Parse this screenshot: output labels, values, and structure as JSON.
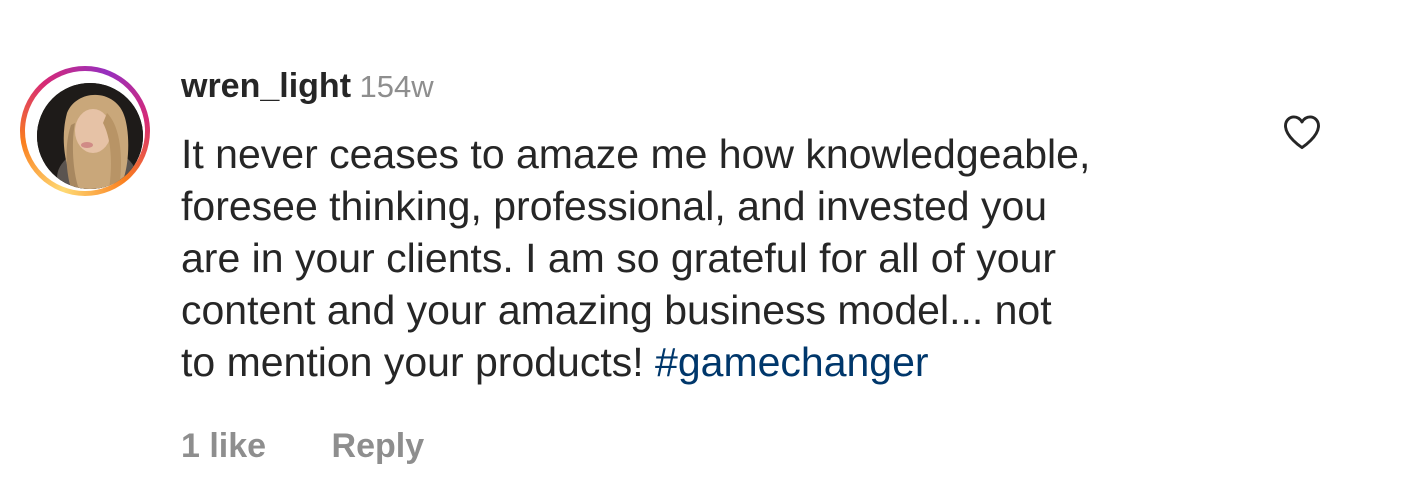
{
  "comment": {
    "username": "wren_light",
    "time_ago": "154w",
    "text_lines": [
      "It never ceases to amaze me how knowledgeable,",
      "foresee thinking, professional, and invested you",
      "are in your clients. I am so grateful for all of your",
      "content and your amazing business model... not",
      "to mention your products! "
    ],
    "hashtag": "#gamechanger",
    "likes_label": "1 like",
    "reply_label": "Reply",
    "like_icon": "heart-outline-icon",
    "avatar_has_story_ring": true
  },
  "colors": {
    "text": "#262626",
    "secondary": "#8e8e8e",
    "hashtag": "#00376b",
    "story_ring": [
      "#feda75",
      "#fa7e1e",
      "#d62976",
      "#962fbf"
    ]
  }
}
